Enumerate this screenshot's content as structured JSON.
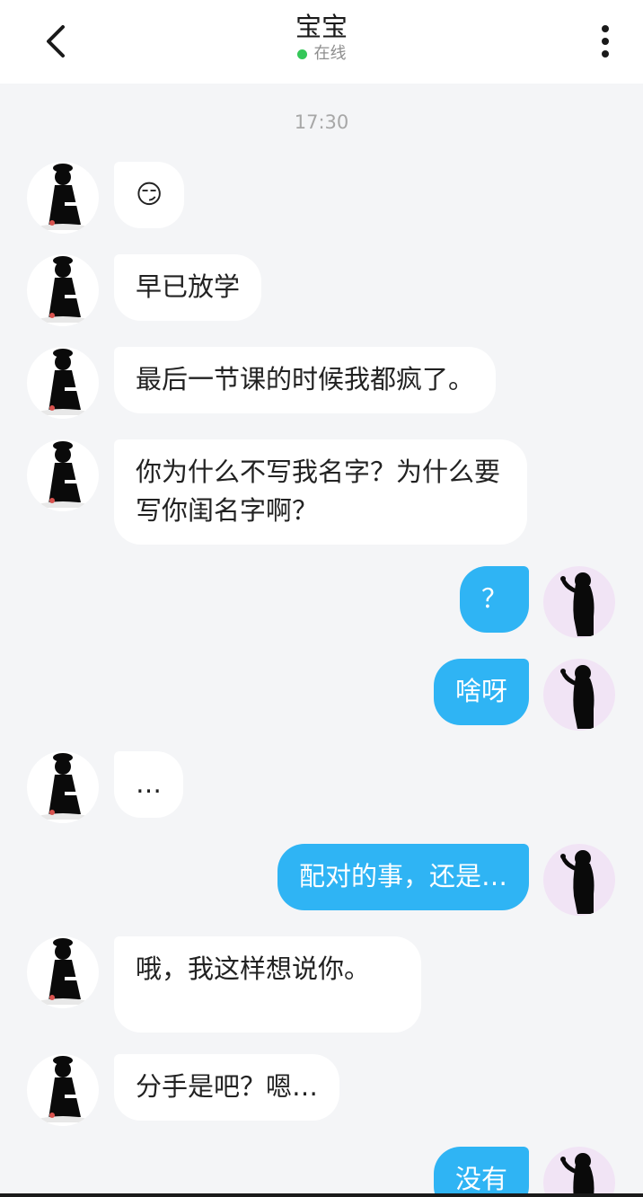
{
  "header": {
    "back_icon": "chevron-left-icon",
    "title": "宝宝",
    "status": "在线",
    "status_color": "#35c759",
    "more_icon": "more-vertical-icon"
  },
  "colors": {
    "outgoing_bubble": "#2fb4f4",
    "incoming_bubble": "#ffffff",
    "background": "#f4f5f7"
  },
  "chat": {
    "timestamp": "17:30",
    "messages": [
      {
        "side": "left",
        "text": "😏"
      },
      {
        "side": "left",
        "text": "早已放学"
      },
      {
        "side": "left",
        "text": "最后一节课的时候我都疯了。"
      },
      {
        "side": "left",
        "text": "你为什么不写我名字？为什么要写你闺名字啊？"
      },
      {
        "side": "right",
        "text": "？"
      },
      {
        "side": "right",
        "text": "啥呀"
      },
      {
        "side": "left",
        "text": "…"
      },
      {
        "side": "right",
        "text": "配对的事，还是…"
      },
      {
        "side": "left",
        "text": "哦，我这样想说你。"
      },
      {
        "side": "left",
        "text": "分手是吧？嗯…"
      },
      {
        "side": "right",
        "text": "没有"
      }
    ]
  }
}
